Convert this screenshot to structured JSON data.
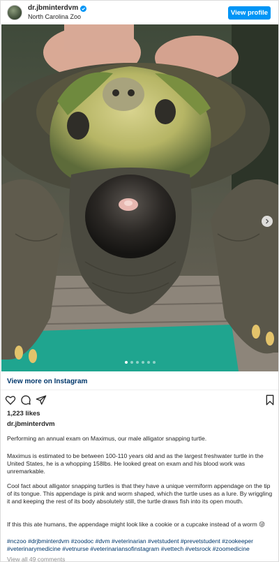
{
  "header": {
    "username": "dr.jbminterdvm",
    "location": "North Carolina Zoo",
    "view_profile_label": "View profile"
  },
  "carousel": {
    "slide_count": 6,
    "active_index": 0
  },
  "view_more_label": "View more on Instagram",
  "likes_text": "1,223 likes",
  "caption": {
    "username": "dr.jbminterdvm",
    "paragraphs": [
      "Performing an annual exam on Maximus, our male alligator snapping turtle.",
      "Maximus is estimated to be between 100-110 years old and as the largest freshwater turtle in the United States, he is a whopping 158lbs. He looked great on exam and his blood work was unremarkable.",
      "Cool fact about alligator snapping turtles is that they have a unique vermiform appendage on the tip of its tongue. This appendage is pink and worm shaped, which the turtle uses as a lure. By wriggling it and keeping the rest of its body absolutely still, the turtle draws fish into its open mouth.",
      "If this this ate humans, the appendage might look like a cookie or a cupcake instead of a worm 😜"
    ],
    "hashtags": "#nczoo #drjbminterdvm #zoodoc #dvm #veterinarian #vetstudent #prevetstudent #zookeeper #veterinarymedicine #vetnurse #veterinariansofinstagram #vettech #vetsrock #zoomedicine"
  },
  "view_all_comments": "View all 49 comments",
  "icons": [
    "verified-badge-icon",
    "heart-icon",
    "comment-icon",
    "share-icon",
    "bookmark-icon",
    "chevron-right-icon"
  ],
  "colors": {
    "accent": "#0095f6",
    "link": "#00376b",
    "muted": "#8e8e8e"
  }
}
